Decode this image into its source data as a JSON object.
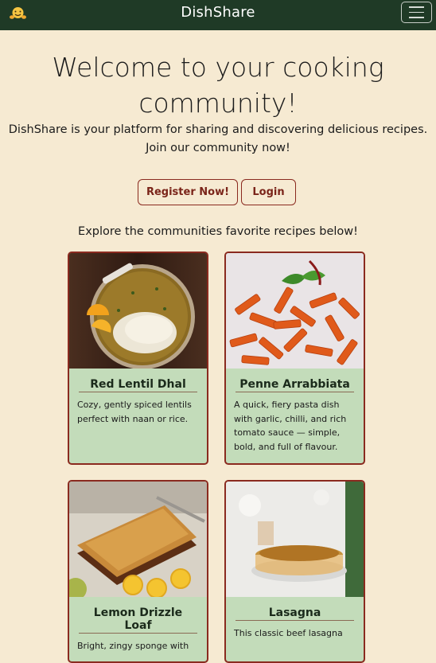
{
  "navbar": {
    "logo_icon": "hugging-face-emoji-icon",
    "title": "DishShare",
    "menu_icon": "hamburger-menu-icon"
  },
  "hero": {
    "title": "Welcome to your cooking community!",
    "text": "DishShare is your platform for sharing and discovering delicious recipes. Join our community now!"
  },
  "buttons": {
    "register_label": "Register Now!",
    "login_label": "Login"
  },
  "explore_text": "Explore the communities favorite recipes below!",
  "recipes": [
    {
      "title": "Red Lentil Dhal",
      "description": "Cozy, gently spiced lentils perfect with naan or rice."
    },
    {
      "title": "Penne Arrabbiata",
      "description": "A quick, fiery pasta dish with garlic, chilli, and rich tomato sauce — simple, bold, and full of flavour."
    },
    {
      "title": "Lemon Drizzle Loaf",
      "description": "Bright, zingy sponge with"
    },
    {
      "title": "Lasagna",
      "description": "This classic beef lasagna"
    }
  ],
  "colors": {
    "navbar": "#1f3a26",
    "background": "#f6ead2",
    "accent": "#8a2a1f",
    "card": "#c3dcba"
  }
}
